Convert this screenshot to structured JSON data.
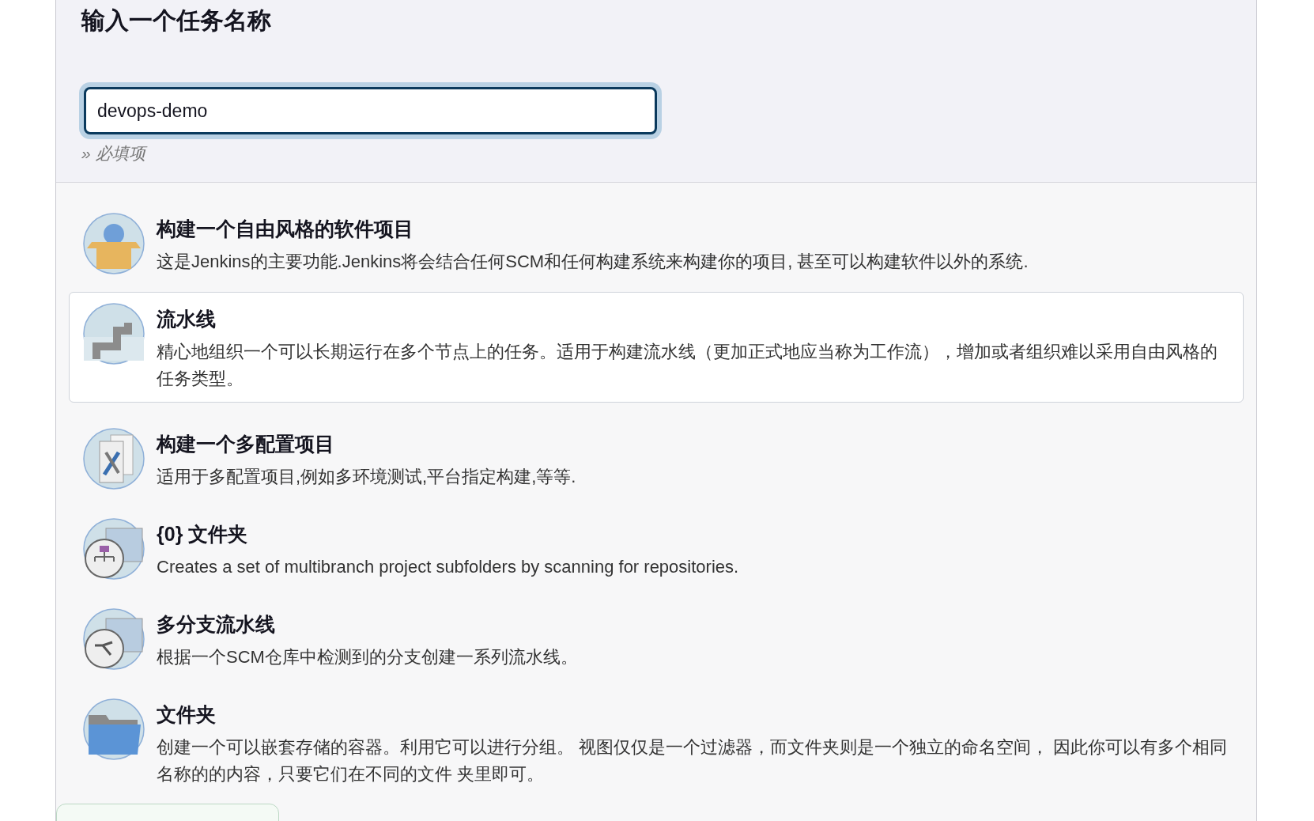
{
  "header": {
    "title": "输入一个任务名称",
    "name_field": {
      "value": "devops-demo",
      "focused": true
    },
    "hint": "» 必填项"
  },
  "items": [
    {
      "kind": "freestyle",
      "title": "构建一个自由风格的软件项目",
      "description": "这是Jenkins的主要功能.Jenkins将会结合任何SCM和任何构建系统来构建你的项目, 甚至可以构建软件以外的系统.",
      "selected": false
    },
    {
      "kind": "pipeline",
      "title": "流水线",
      "description": "精心地组织一个可以长期运行在多个节点上的任务。适用于构建流水线（更加正式地应当称为工作流），增加或者组织难以采用自由风格的任务类型。",
      "selected": true
    },
    {
      "kind": "matrix",
      "title": "构建一个多配置项目",
      "description": "适用于多配置项目,例如多环境测试,平台指定构建,等等.",
      "selected": false
    },
    {
      "kind": "org-folder",
      "title": "{0} 文件夹",
      "description": "Creates a set of multibranch project subfolders by scanning for repositories.",
      "selected": false
    },
    {
      "kind": "multibranch",
      "title": "多分支流水线",
      "description": "根据一个SCM仓库中检测到的分支创建一系列流水线。",
      "selected": false
    },
    {
      "kind": "folder",
      "title": "文件夹",
      "description": "创建一个可以嵌套存储的容器。利用它可以进行分组。 视图仅仅是一个过滤器，而文件夹则是一个独立的命名空间， 因此你可以有多个相同名称的的内容，只要它们在不同的文件 夹里即可。",
      "selected": false
    }
  ]
}
